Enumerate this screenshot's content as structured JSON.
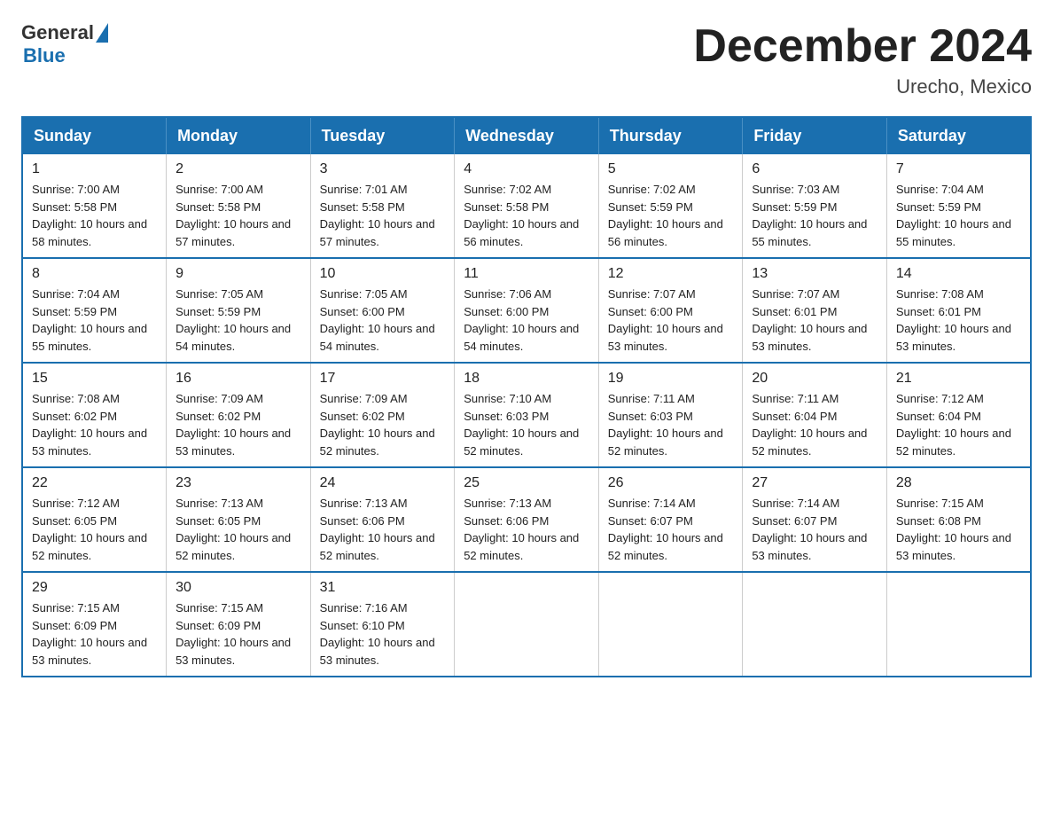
{
  "logo": {
    "line1": "General",
    "triangle": true,
    "line2": "Blue"
  },
  "title": {
    "month_year": "December 2024",
    "location": "Urecho, Mexico"
  },
  "weekdays": [
    "Sunday",
    "Monday",
    "Tuesday",
    "Wednesday",
    "Thursday",
    "Friday",
    "Saturday"
  ],
  "weeks": [
    [
      {
        "day": "1",
        "sunrise": "7:00 AM",
        "sunset": "5:58 PM",
        "daylight": "10 hours and 58 minutes."
      },
      {
        "day": "2",
        "sunrise": "7:00 AM",
        "sunset": "5:58 PM",
        "daylight": "10 hours and 57 minutes."
      },
      {
        "day": "3",
        "sunrise": "7:01 AM",
        "sunset": "5:58 PM",
        "daylight": "10 hours and 57 minutes."
      },
      {
        "day": "4",
        "sunrise": "7:02 AM",
        "sunset": "5:58 PM",
        "daylight": "10 hours and 56 minutes."
      },
      {
        "day": "5",
        "sunrise": "7:02 AM",
        "sunset": "5:59 PM",
        "daylight": "10 hours and 56 minutes."
      },
      {
        "day": "6",
        "sunrise": "7:03 AM",
        "sunset": "5:59 PM",
        "daylight": "10 hours and 55 minutes."
      },
      {
        "day": "7",
        "sunrise": "7:04 AM",
        "sunset": "5:59 PM",
        "daylight": "10 hours and 55 minutes."
      }
    ],
    [
      {
        "day": "8",
        "sunrise": "7:04 AM",
        "sunset": "5:59 PM",
        "daylight": "10 hours and 55 minutes."
      },
      {
        "day": "9",
        "sunrise": "7:05 AM",
        "sunset": "5:59 PM",
        "daylight": "10 hours and 54 minutes."
      },
      {
        "day": "10",
        "sunrise": "7:05 AM",
        "sunset": "6:00 PM",
        "daylight": "10 hours and 54 minutes."
      },
      {
        "day": "11",
        "sunrise": "7:06 AM",
        "sunset": "6:00 PM",
        "daylight": "10 hours and 54 minutes."
      },
      {
        "day": "12",
        "sunrise": "7:07 AM",
        "sunset": "6:00 PM",
        "daylight": "10 hours and 53 minutes."
      },
      {
        "day": "13",
        "sunrise": "7:07 AM",
        "sunset": "6:01 PM",
        "daylight": "10 hours and 53 minutes."
      },
      {
        "day": "14",
        "sunrise": "7:08 AM",
        "sunset": "6:01 PM",
        "daylight": "10 hours and 53 minutes."
      }
    ],
    [
      {
        "day": "15",
        "sunrise": "7:08 AM",
        "sunset": "6:02 PM",
        "daylight": "10 hours and 53 minutes."
      },
      {
        "day": "16",
        "sunrise": "7:09 AM",
        "sunset": "6:02 PM",
        "daylight": "10 hours and 53 minutes."
      },
      {
        "day": "17",
        "sunrise": "7:09 AM",
        "sunset": "6:02 PM",
        "daylight": "10 hours and 52 minutes."
      },
      {
        "day": "18",
        "sunrise": "7:10 AM",
        "sunset": "6:03 PM",
        "daylight": "10 hours and 52 minutes."
      },
      {
        "day": "19",
        "sunrise": "7:11 AM",
        "sunset": "6:03 PM",
        "daylight": "10 hours and 52 minutes."
      },
      {
        "day": "20",
        "sunrise": "7:11 AM",
        "sunset": "6:04 PM",
        "daylight": "10 hours and 52 minutes."
      },
      {
        "day": "21",
        "sunrise": "7:12 AM",
        "sunset": "6:04 PM",
        "daylight": "10 hours and 52 minutes."
      }
    ],
    [
      {
        "day": "22",
        "sunrise": "7:12 AM",
        "sunset": "6:05 PM",
        "daylight": "10 hours and 52 minutes."
      },
      {
        "day": "23",
        "sunrise": "7:13 AM",
        "sunset": "6:05 PM",
        "daylight": "10 hours and 52 minutes."
      },
      {
        "day": "24",
        "sunrise": "7:13 AM",
        "sunset": "6:06 PM",
        "daylight": "10 hours and 52 minutes."
      },
      {
        "day": "25",
        "sunrise": "7:13 AM",
        "sunset": "6:06 PM",
        "daylight": "10 hours and 52 minutes."
      },
      {
        "day": "26",
        "sunrise": "7:14 AM",
        "sunset": "6:07 PM",
        "daylight": "10 hours and 52 minutes."
      },
      {
        "day": "27",
        "sunrise": "7:14 AM",
        "sunset": "6:07 PM",
        "daylight": "10 hours and 53 minutes."
      },
      {
        "day": "28",
        "sunrise": "7:15 AM",
        "sunset": "6:08 PM",
        "daylight": "10 hours and 53 minutes."
      }
    ],
    [
      {
        "day": "29",
        "sunrise": "7:15 AM",
        "sunset": "6:09 PM",
        "daylight": "10 hours and 53 minutes."
      },
      {
        "day": "30",
        "sunrise": "7:15 AM",
        "sunset": "6:09 PM",
        "daylight": "10 hours and 53 minutes."
      },
      {
        "day": "31",
        "sunrise": "7:16 AM",
        "sunset": "6:10 PM",
        "daylight": "10 hours and 53 minutes."
      },
      null,
      null,
      null,
      null
    ]
  ]
}
